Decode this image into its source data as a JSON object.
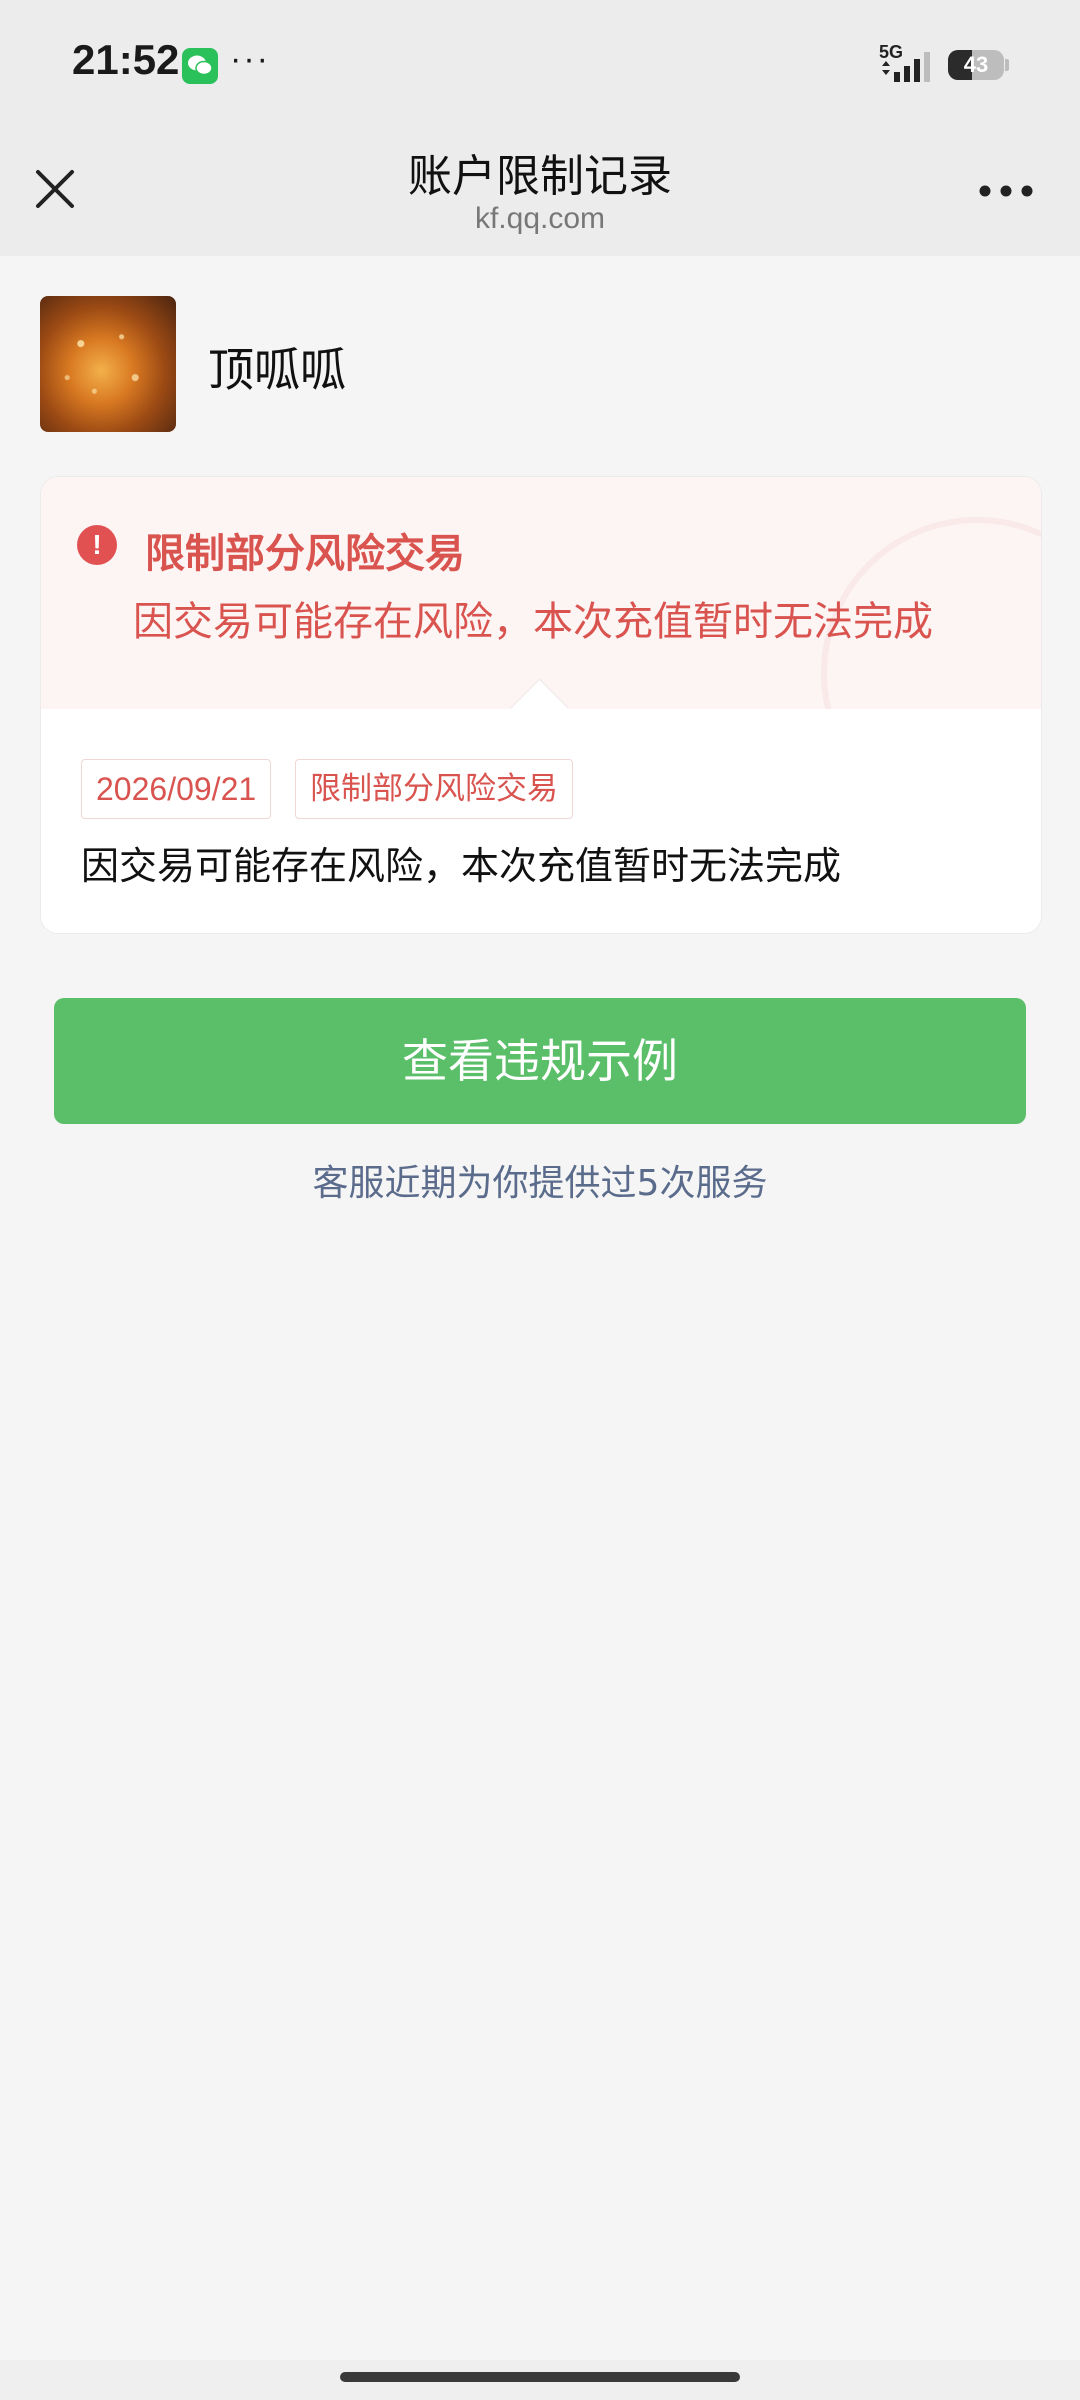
{
  "status_bar": {
    "time": "21:52",
    "more": "···",
    "network": "5G",
    "battery": "43",
    "battery_level": 0.43
  },
  "nav": {
    "title": "账户限制记录",
    "subtitle": "kf.qq.com"
  },
  "profile": {
    "name": "顶呱呱"
  },
  "restriction": {
    "title": "限制部分风险交易",
    "description": "因交易可能存在风险，本次充值暂时无法完成",
    "date": "2026/09/21",
    "type_tag": "限制部分风险交易",
    "detail": "因交易可能存在风险，本次充值暂时无法完成"
  },
  "actions": {
    "view_example": "查看违规示例",
    "service_note": "客服近期为你提供过5次服务"
  },
  "colors": {
    "alert_red": "#d9534f",
    "primary_green": "#5bbf6a",
    "link_blue": "#5a6b8c"
  }
}
